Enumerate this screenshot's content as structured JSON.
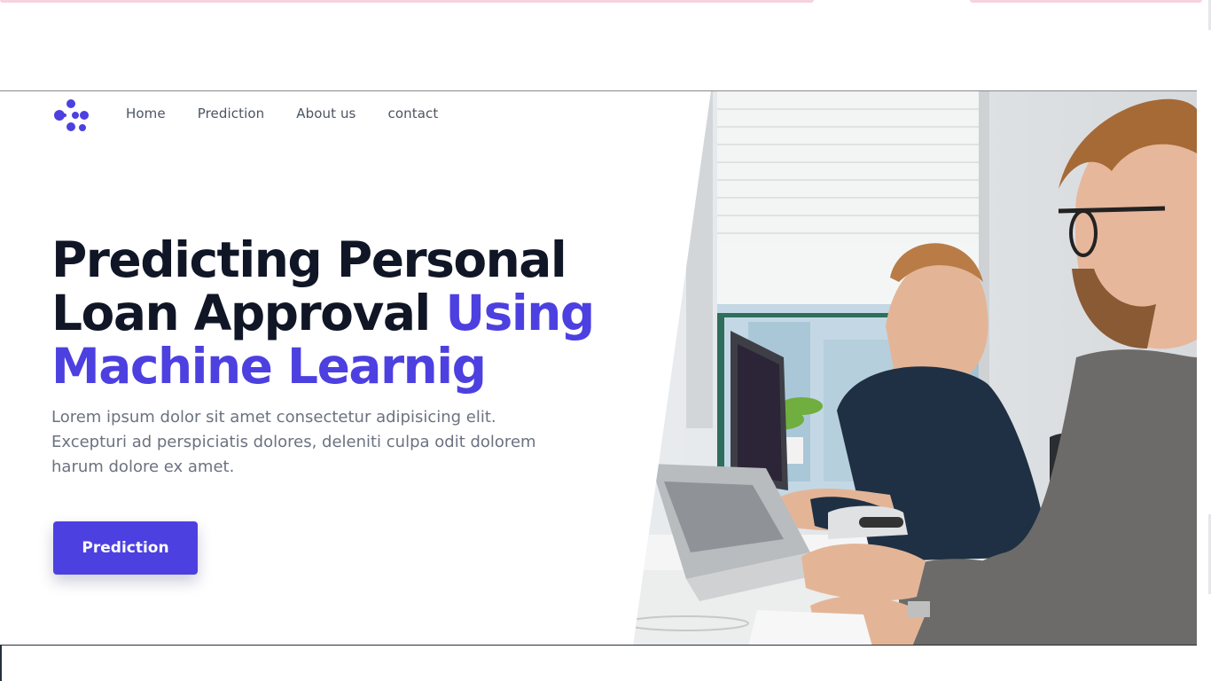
{
  "nav": {
    "items": [
      {
        "label": "Home"
      },
      {
        "label": "Prediction"
      },
      {
        "label": "About us"
      },
      {
        "label": "contact"
      }
    ]
  },
  "hero": {
    "title_part1": "Predicting Personal Loan Approval ",
    "title_accent": "Using Machine Learnig",
    "description": "Lorem ipsum dolor sit amet consectetur adipisicing elit. Excepturi ad perspiciatis dolores, deleniti culpa odit dolorem harum dolore ex amet.",
    "cta_label": "Prediction"
  },
  "icons": {
    "logo": "dots-logo-icon"
  },
  "colors": {
    "accent": "#4d40e0",
    "heading": "#101626",
    "body_text": "#6b7280",
    "nav_text": "#4b5563"
  }
}
